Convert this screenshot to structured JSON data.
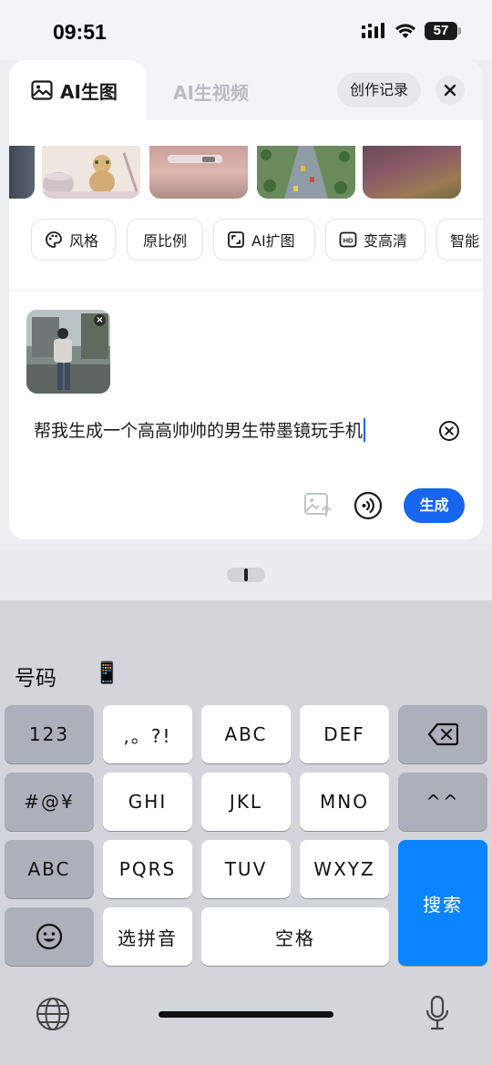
{
  "status_bar": {
    "time": "09:51",
    "battery": "57"
  },
  "panel": {
    "tabs": [
      {
        "label": "AI生图",
        "icon": "image-icon",
        "active": true
      },
      {
        "label": "AI生视频",
        "active": false
      }
    ],
    "history_button": "创作记录",
    "chips": [
      {
        "label": "风格",
        "icon": "palette-icon"
      },
      {
        "label": "原比例"
      },
      {
        "label": "AI扩图",
        "icon": "expand-icon"
      },
      {
        "label": "变高清",
        "icon": "hd-icon"
      },
      {
        "label": "智能"
      }
    ],
    "prompt": "帮我生成一个高高帅帅的男生带墨镜玩手机",
    "ref_remove": "×",
    "generate_button": "生成"
  },
  "keyboard": {
    "candidates": [
      "号码",
      "📱"
    ],
    "rows": [
      [
        "123",
        ",。?!",
        "ABC",
        "DEF",
        "delete"
      ],
      [
        "#@¥",
        "GHI",
        "JKL",
        "MNO",
        "^^"
      ],
      [
        "ABC",
        "PQRS",
        "TUV",
        "WXYZ"
      ],
      [
        "emoji",
        "选拼音",
        "空格"
      ]
    ],
    "search_key": "搜索",
    "accent_color": "#0a84ff"
  }
}
